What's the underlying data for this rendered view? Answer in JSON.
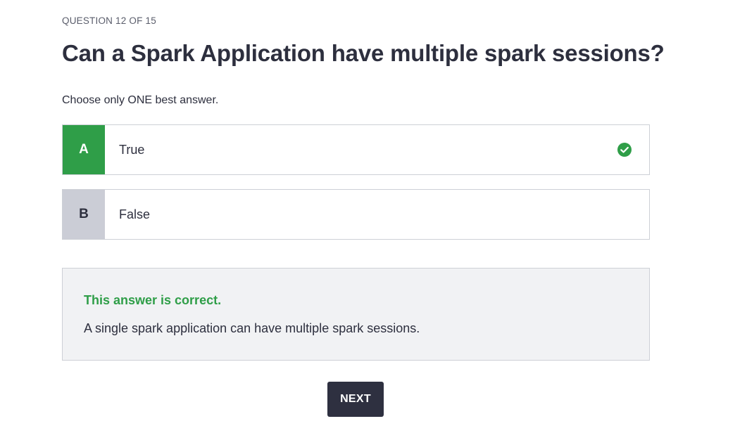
{
  "quiz": {
    "progress": "QUESTION 12 OF 15",
    "question": "Can a Spark Application have multiple spark sessions?",
    "instruction": "Choose only ONE best answer.",
    "options": [
      {
        "letter": "A",
        "text": "True",
        "selected": true,
        "correct": true,
        "icon": "check-circle-icon"
      },
      {
        "letter": "B",
        "text": "False",
        "selected": false,
        "correct": false
      }
    ]
  },
  "feedback": {
    "title": "This answer is correct.",
    "explanation": "A single spark application can have multiple spark sessions."
  },
  "actions": {
    "next_label": "NEXT"
  },
  "colors": {
    "correct_green": "#2f9e48",
    "neutral_letter_bg": "#cbcdd6",
    "text_dark": "#2d2f3e",
    "feedback_bg": "#f1f2f4",
    "button_bg": "#2e3040"
  }
}
